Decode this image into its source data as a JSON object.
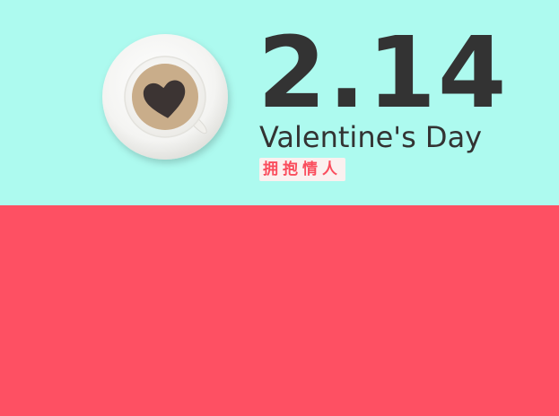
{
  "banner": {
    "date_text": "2.14",
    "event_name": "Valentine's Day",
    "tag_text": "拥抱情人"
  },
  "colors": {
    "top_background": "#adfaef",
    "bottom_background": "#fe5063",
    "text_dark": "#333333",
    "tag_text": "#fa4d5d",
    "coffee": "#c9ad8a",
    "heart": "#3c3433"
  },
  "icons": {
    "cup": "coffee-cup-icon",
    "heart": "heart-icon"
  }
}
